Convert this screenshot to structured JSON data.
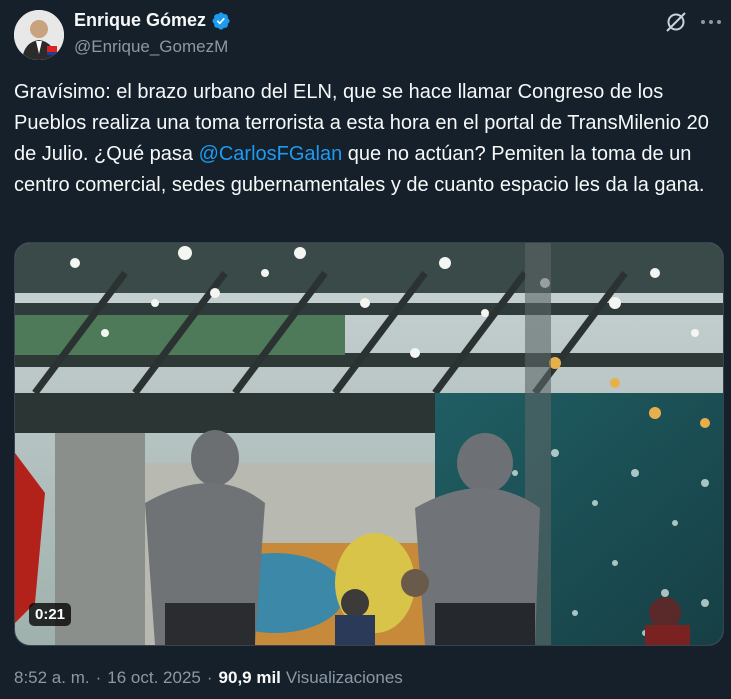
{
  "tweet": {
    "author_name": "Enrique Gómez",
    "author_handle": "@Enrique_GomezM",
    "text_before_mention": "Gravísimo: el brazo urbano del ELN, que se hace llamar Congreso de los Pueblos realiza una toma terrorista a esta hora en el portal de TransMilenio 20 de Julio. ¿Qué pasa ",
    "mention": "@CarlosFGalan",
    "text_after_mention": " que no actúan? Pemiten la toma de un centro comercial, sedes gubernamentales y de cuanto espacio les da la gana.",
    "video_duration": "0:21",
    "time": "8:52 a. m.",
    "separator": "·",
    "date": "16 oct. 2025",
    "views_count": "90,9 mil",
    "views_label": "Visualizaciones"
  },
  "icons": {
    "verified": "verified-badge-icon",
    "grok": "grok-icon",
    "more": "more-dots-icon"
  },
  "colors": {
    "background": "#15202b",
    "text": "#f7f9f9",
    "secondary": "#8b98a5",
    "accent": "#1d9bf0"
  }
}
